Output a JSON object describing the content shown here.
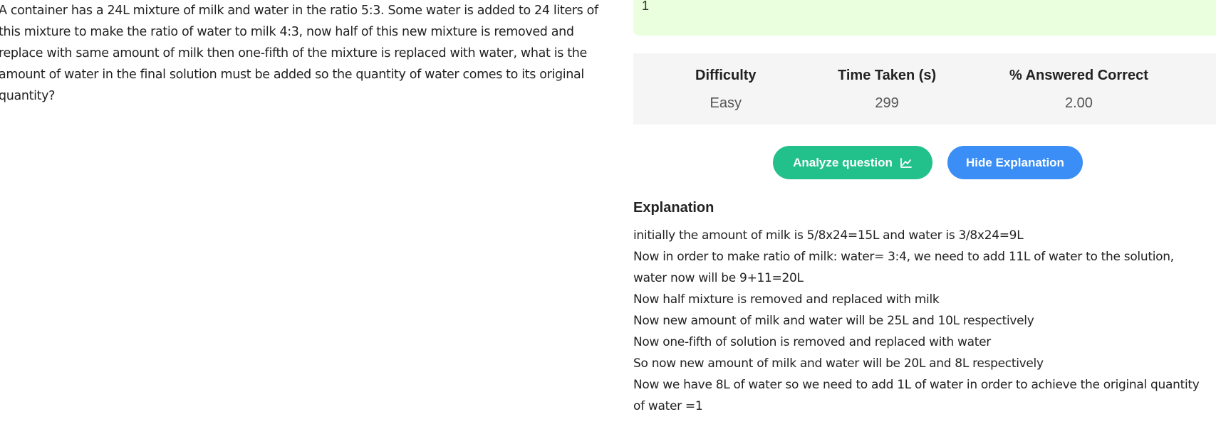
{
  "question": {
    "text": "A container has a 24L mixture of milk and water in the ratio 5:3. Some water is added to 24 liters of this mixture to make the ratio of water to milk 4:3, now half of this new mixture is removed and replace with same amount of milk then one-fifth of the mixture is replaced with water, what is the amount of water in the final solution must be added so the quantity of water comes to its original quantity?"
  },
  "answer": {
    "value": "1"
  },
  "stats": {
    "difficulty_label": "Difficulty",
    "difficulty_value": "Easy",
    "time_label": "Time Taken (s)",
    "time_value": "299",
    "correct_label": "% Answered Correct",
    "correct_value": "2.00"
  },
  "buttons": {
    "analyze_label": "Analyze question",
    "analyze_icon": "chart-line-icon",
    "hide_label": "Hide Explanation"
  },
  "explanation": {
    "title": "Explanation",
    "lines": [
      "initially the amount of milk is 5/8x24=15L and water is 3/8x24=9L",
      "Now in order to make ratio of milk: water= 3:4, we need to add 11L of water to the solution, water now will be 9+11=20L",
      "Now half mixture is removed and replaced with milk",
      "Now new amount of milk and water will be 25L and 10L respectively",
      "Now one-fifth of solution is removed and replaced with water",
      "So now new amount of milk and water will be 20L and 8L respectively",
      "Now we have 8L of water so we need to add 1L of water in order to achieve the original quantity of water =1"
    ]
  },
  "colors": {
    "answer_bg": "#eaffdd",
    "stats_bg": "#f5f5f5",
    "analyze_btn": "#22c08a",
    "hide_btn": "#3b8ef5"
  }
}
